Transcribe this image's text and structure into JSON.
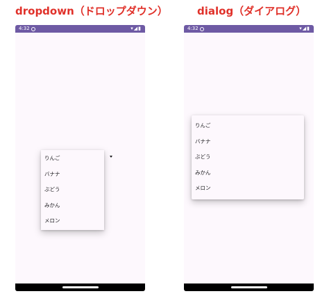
{
  "captions": {
    "left": "dropdown（ドロップダウン）",
    "right": "dialog（ダイアログ）"
  },
  "status_bar": {
    "time": "4:32",
    "icons": "▾◢▮"
  },
  "colors": {
    "status_bar": "#6e5aa4",
    "caption": "#e0312a",
    "screen_background": "#fdf8fd"
  },
  "dropdown": {
    "options": [
      "りんご",
      "バナナ",
      "ぶどう",
      "みかん",
      "メロン"
    ]
  },
  "dialog": {
    "options": [
      "りんご",
      "バナナ",
      "ぶどう",
      "みかん",
      "メロン"
    ]
  }
}
